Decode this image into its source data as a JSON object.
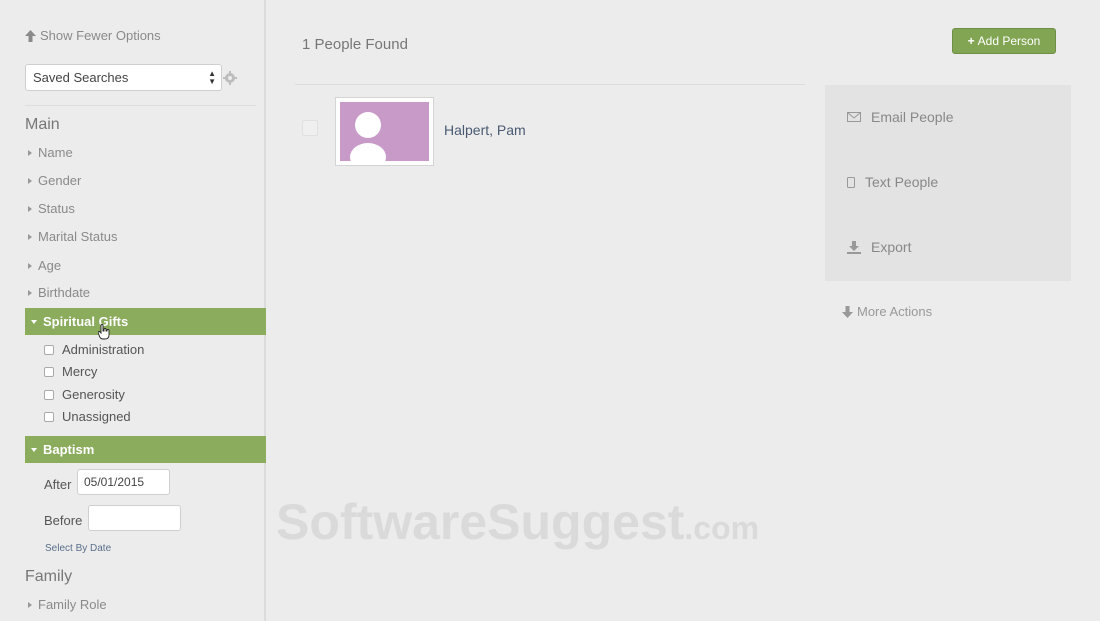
{
  "sidebar": {
    "show_fewer_label": "Show Fewer Options",
    "saved_searches": {
      "selected": "Saved Searches"
    },
    "main_section": {
      "title": "Main",
      "items": [
        {
          "label": "Name"
        },
        {
          "label": "Gender"
        },
        {
          "label": "Status"
        },
        {
          "label": "Marital Status"
        },
        {
          "label": "Age"
        },
        {
          "label": "Birthdate"
        }
      ]
    },
    "spiritual_gifts": {
      "label": "Spiritual Gifts",
      "options": [
        {
          "label": "Administration",
          "checked": false
        },
        {
          "label": "Mercy",
          "checked": false
        },
        {
          "label": "Generosity",
          "checked": false
        },
        {
          "label": "Unassigned",
          "checked": false
        }
      ]
    },
    "baptism": {
      "label": "Baptism",
      "after_label": "After",
      "after_value": "05/01/2015",
      "before_label": "Before",
      "before_value": "",
      "select_by_date": "Select By Date"
    },
    "family_section": {
      "title": "Family",
      "items": [
        {
          "label": "Family Role"
        }
      ]
    }
  },
  "main": {
    "results_count": "1 People Found",
    "add_person_label": "Add Person",
    "people": [
      {
        "name": "Halpert, Pam"
      }
    ]
  },
  "actions": {
    "email": "Email People",
    "text": "Text People",
    "export": "Export",
    "more": "More Actions"
  },
  "watermark": {
    "main": "SoftwareSuggest",
    "suffix": ".com"
  },
  "colors": {
    "accent_green": "#8bab5d",
    "button_green": "#82a553",
    "avatar_bg": "#c79ac7",
    "link_blue": "#4a5a72"
  }
}
